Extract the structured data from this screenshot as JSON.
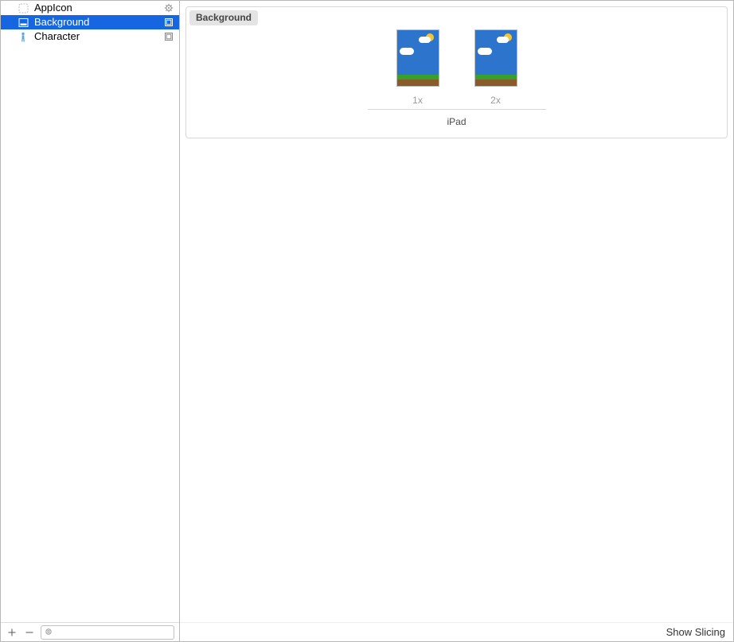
{
  "sidebar": {
    "items": [
      {
        "label": "AppIcon",
        "icon": "appicon",
        "rightIcon": "gear"
      },
      {
        "label": "Background",
        "icon": "image",
        "rightIcon": "square"
      },
      {
        "label": "Character",
        "icon": "person",
        "rightIcon": "square"
      }
    ],
    "filterPlaceholder": ""
  },
  "detail": {
    "title": "Background",
    "scales": [
      "1x",
      "2x"
    ],
    "device": "iPad"
  },
  "footer": {
    "showSlicing": "Show Slicing"
  }
}
